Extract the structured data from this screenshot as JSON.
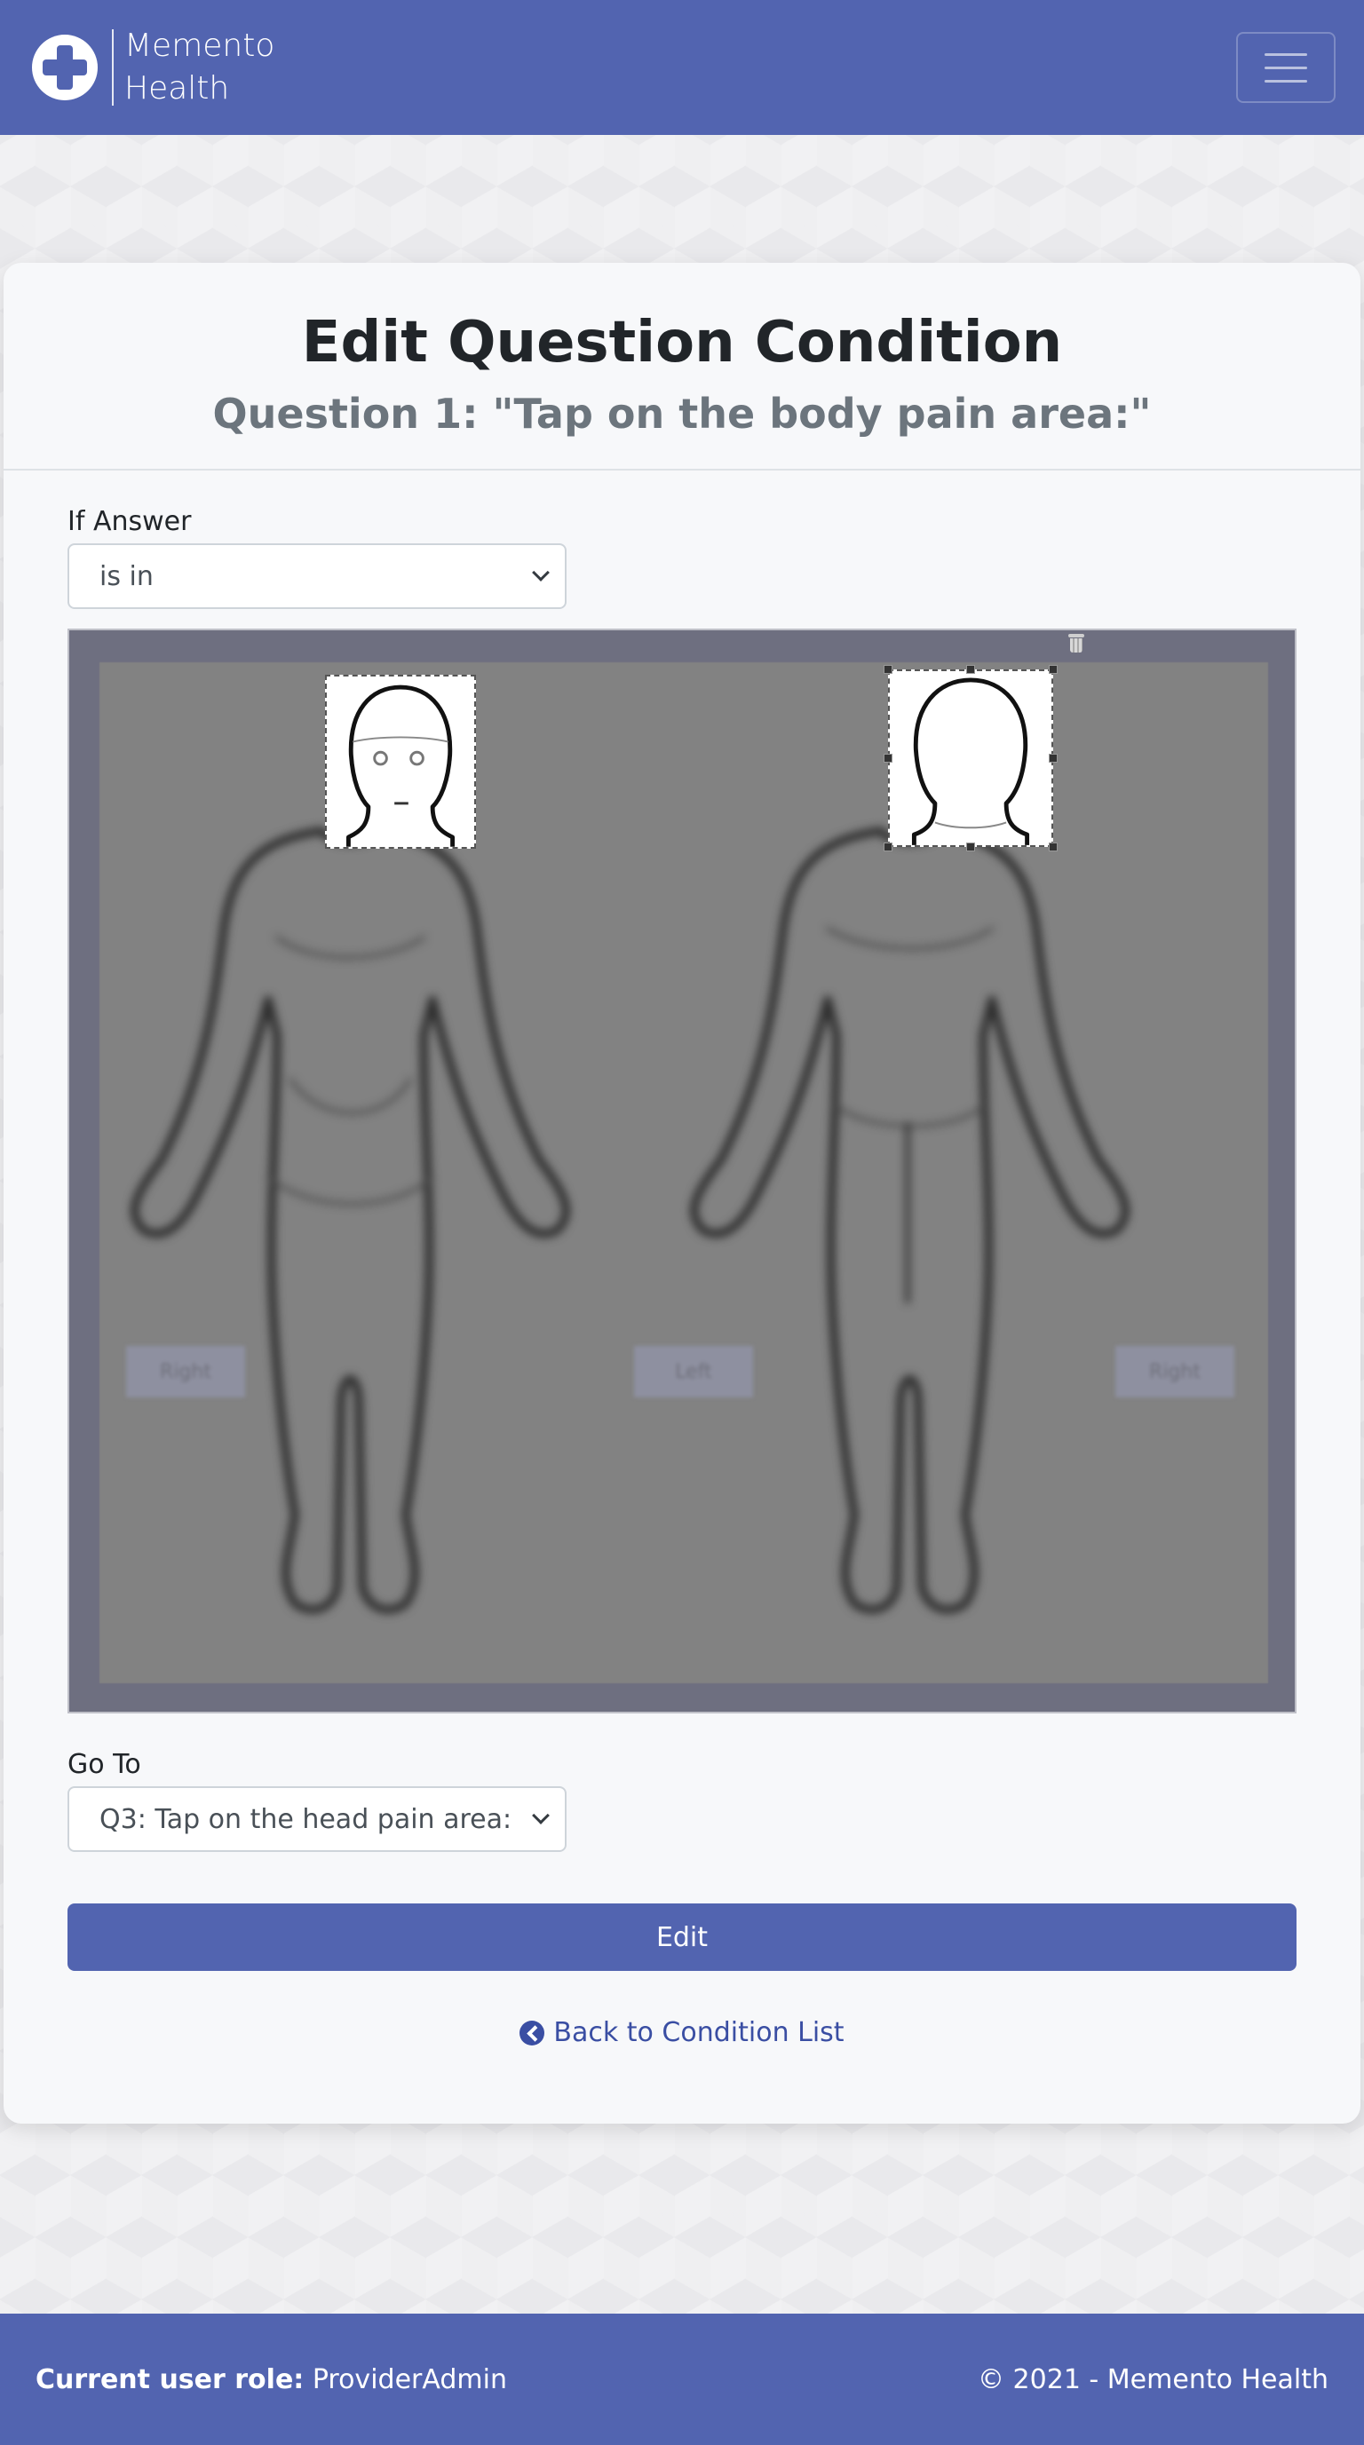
{
  "header": {
    "brand_line1": "Memento",
    "brand_line2": "Health",
    "brand_icon": "medical-cross-icon",
    "menu_icon": "hamburger-menu-icon"
  },
  "page": {
    "title": "Edit Question Condition",
    "subtitle": "Question 1: \"Tap on the body pain area:\""
  },
  "form": {
    "if_answer_label": "If Answer",
    "if_answer_value": "is in",
    "go_to_label": "Go To",
    "go_to_value": "Q3: Tap on the head pain area:",
    "edit_button": "Edit",
    "back_link": "Back to Condition List"
  },
  "body_map": {
    "label_front_right": "Right",
    "label_center_left": "Left",
    "label_back_right": "Right",
    "selected_region": "head"
  },
  "footer": {
    "role_label": "Current user role:",
    "role_value": "ProviderAdmin",
    "copyright": "© 2021 - Memento Health"
  },
  "colors": {
    "primary": "#5264b0",
    "link": "#3a4ea3",
    "card_bg": "#f7f8fa",
    "subtitle": "#6c757d"
  }
}
